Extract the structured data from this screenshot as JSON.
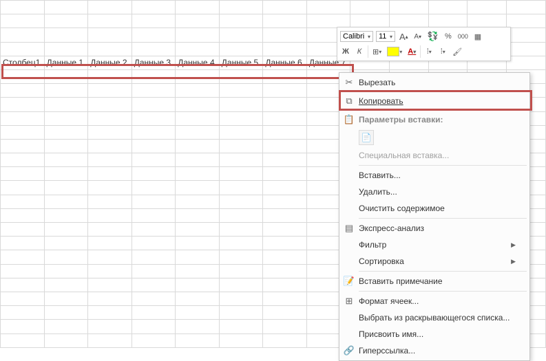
{
  "grid": {
    "headers": [
      "Столбец1",
      "Данные 1",
      "Данные 2",
      "Данные 3",
      "Данные 4",
      "Данные 5",
      "Данные 6",
      "Данные 7"
    ]
  },
  "miniToolbar": {
    "fontName": "Calibri",
    "fontSize": "11",
    "increaseFont": "A",
    "decreaseFont": "A",
    "percent": "%",
    "thousands": "000",
    "bold": "Ж",
    "italic": "К",
    "fontColor": "A"
  },
  "contextMenu": {
    "cut": "Вырезать",
    "copy": "Копировать",
    "pasteOptionsHeader": "Параметры вставки:",
    "pasteSpecial": "Специальная вставка...",
    "insert": "Вставить...",
    "delete": "Удалить...",
    "clearContents": "Очистить содержимое",
    "quickAnalysis": "Экспресс-анализ",
    "filter": "Фильтр",
    "sort": "Сортировка",
    "insertComment": "Вставить примечание",
    "formatCells": "Формат ячеек...",
    "pickFromList": "Выбрать из раскрывающегося списка...",
    "defineName": "Присвоить имя...",
    "hyperlink": "Гиперссылка..."
  }
}
